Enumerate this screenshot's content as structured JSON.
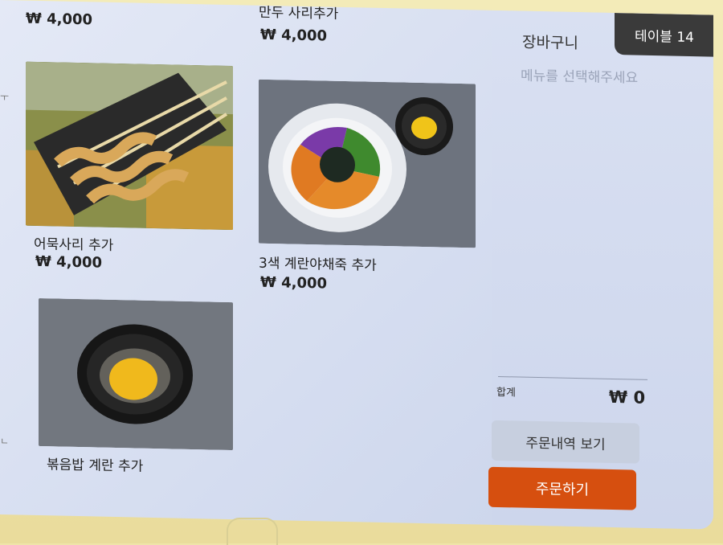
{
  "menu": {
    "items": [
      {
        "name": "",
        "price": "₩ 4,000"
      },
      {
        "name": "만두 사리추가",
        "price": "₩ 4,000"
      },
      {
        "name": "어묵사리 추가",
        "price": "₩ 4,000"
      },
      {
        "name": "3색 계란야채죽 추가",
        "price": "₩ 4,000"
      },
      {
        "name": "볶음밥 계란 추가",
        "price": ""
      }
    ]
  },
  "cart": {
    "title": "장바구니",
    "hint": "메뉴를 선택해주세요",
    "table_badge": "테이블 14",
    "total_label": "합계",
    "total_value": "₩ 0",
    "history_button": "주문내역 보기",
    "order_button": "주문하기"
  },
  "colors": {
    "order_button": "#d64f0f",
    "badge": "#3a3a3a",
    "bezel": "#efe4a9"
  }
}
